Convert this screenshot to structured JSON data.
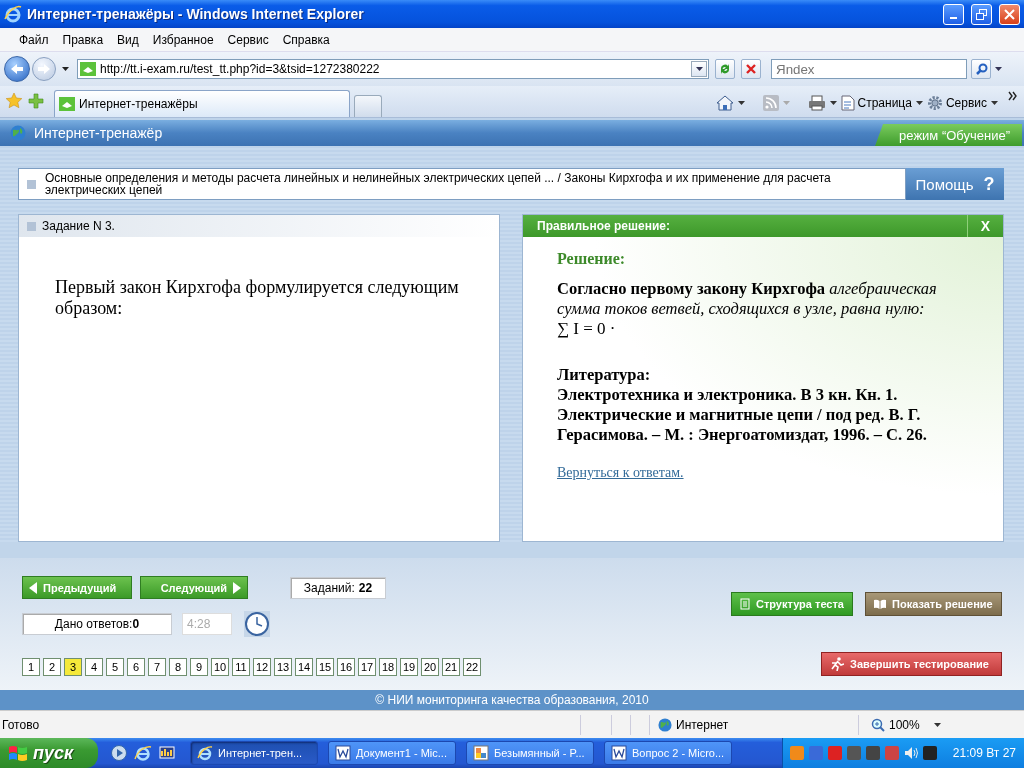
{
  "window": {
    "title": "Интернет-тренажёры - Windows Internet Explorer"
  },
  "menu": [
    "Файл",
    "Правка",
    "Вид",
    "Избранное",
    "Сервис",
    "Справка"
  ],
  "address_bar": {
    "url": "http://tt.i-exam.ru/test_tt.php?id=3&tsid=1272380222"
  },
  "search": {
    "placeholder": "Яndex"
  },
  "tabs": [
    {
      "label": "Интернет-тренажёры",
      "selected": true
    }
  ],
  "command_bar": [
    "Страница",
    "Сервис"
  ],
  "app": {
    "title": "Интернет-тренажёр",
    "mode": "режим “Обучение”"
  },
  "breadcrumb": "Основные определения и методы расчета линейных и нелинейных электрических цепей ... / Законы Кирхгофа и их применение для расчета электрических цепей",
  "help_button": {
    "label": "Помощь",
    "icon": "?"
  },
  "task": {
    "header": "Задание N 3.",
    "question": "Первый закон Кирхгофа формулируется следующим образом:"
  },
  "solution": {
    "header": "Правильное решение:",
    "close": "X",
    "heading": "Решение:",
    "text": "Согласно первому закону Кирхгофа *алгебраическая сумма токов ветвей, сходящихся в узле, равна нулю:*",
    "formula": "∑ I = 0 ·",
    "literature_heading": "Литература:",
    "literature": "Электротехника и электроника. В 3 кн. Кн. 1. Электрические и магнитные цепи / под ред. В. Г. Герасимова. – М. : Энергоатомиздат, 1996. – С. 26.",
    "link": "Вернуться к ответам."
  },
  "navigation": {
    "previous": "Предыдущий",
    "next": "Следующий",
    "tasks_label": "Заданий:",
    "tasks_count": "22",
    "answers_label": "Дано ответов:",
    "answers_count": "0",
    "timer": "4:28"
  },
  "actions": [
    {
      "label": "Структура теста",
      "kind": "structure"
    },
    {
      "label": "Показать решение",
      "kind": "solution"
    },
    {
      "label": "Завершить тестирование",
      "kind": "finish"
    }
  ],
  "pages": [
    {
      "label": "1",
      "selected": false
    },
    {
      "label": "2",
      "selected": false
    },
    {
      "label": "3",
      "selected": true
    },
    {
      "label": "4",
      "selected": false
    },
    {
      "label": "5",
      "selected": false
    },
    {
      "label": "6",
      "selected": false
    },
    {
      "label": "7",
      "selected": false
    },
    {
      "label": "8",
      "selected": false
    },
    {
      "label": "9",
      "selected": false
    },
    {
      "label": "10",
      "selected": false
    },
    {
      "label": "11",
      "selected": false
    },
    {
      "label": "12",
      "selected": false
    },
    {
      "label": "13",
      "selected": false
    },
    {
      "label": "14",
      "selected": false
    },
    {
      "label": "15",
      "selected": false
    },
    {
      "label": "16",
      "selected": false
    },
    {
      "label": "17",
      "selected": false
    },
    {
      "label": "18",
      "selected": false
    },
    {
      "label": "19",
      "selected": false
    },
    {
      "label": "20",
      "selected": false
    },
    {
      "label": "21",
      "selected": false
    },
    {
      "label": "22",
      "selected": false
    }
  ],
  "footer": "© НИИ мониторинга качества образования, 2010",
  "status_bar": {
    "text": "Готово",
    "zone": "Интернет",
    "zoom": "100%"
  },
  "taskbar": {
    "start": "пуск",
    "tasks": [
      {
        "label": "Интернет-трен...",
        "selected": true,
        "kind": "ie"
      },
      {
        "label": "Документ1 - Mic...",
        "selected": false,
        "kind": "word"
      },
      {
        "label": "Безымянный - P...",
        "selected": false,
        "kind": "paint"
      },
      {
        "label": "Вопрос  2 - Micro...",
        "selected": false,
        "kind": "word"
      }
    ],
    "clock": "21:09 Вт 27"
  }
}
